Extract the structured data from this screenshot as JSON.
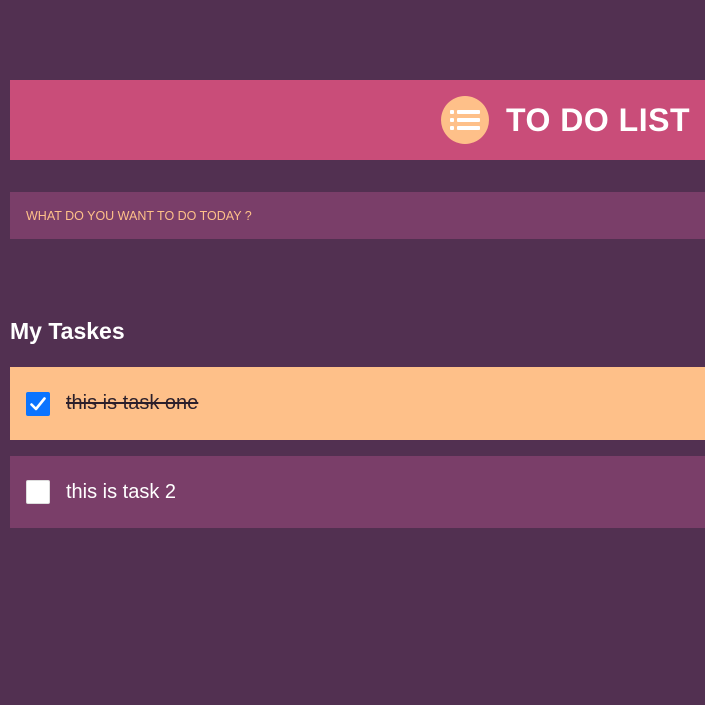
{
  "header": {
    "title": "TO DO LIST",
    "icon": "list-icon"
  },
  "input": {
    "placeholder": "WHAT DO YOU WANT TO DO TODAY ?",
    "value": ""
  },
  "section": {
    "title": "My Taskes"
  },
  "tasks": [
    {
      "label": "this is task one",
      "checked": true
    },
    {
      "label": "this is task 2",
      "checked": false
    }
  ],
  "colors": {
    "background": "#523051",
    "header": "#c94d79",
    "accent": "#fec089",
    "row": "#7a3e69",
    "checkbox": "#0b74ff"
  }
}
